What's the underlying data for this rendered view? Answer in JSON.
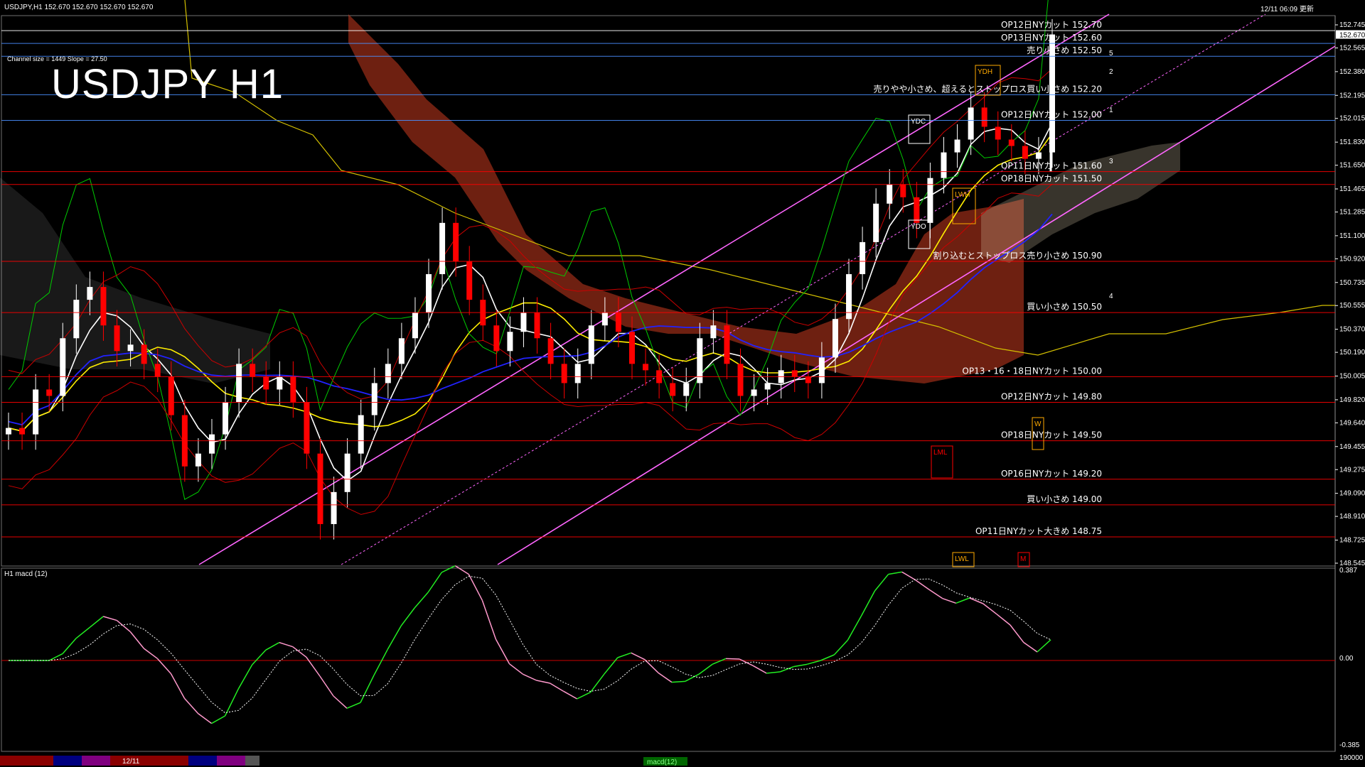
{
  "header": {
    "symbol_line": "USDJPY,H1  152.670 152.670 152.670 152.670",
    "channel_info": "Channel size = 1449 Slope = 27.50",
    "datetime": "12/11 06:09 更新",
    "big_title": "USDJPY H1",
    "macd_label": "H1  macd (12)"
  },
  "price_axis": {
    "ticks": [
      "152.745",
      "152.565",
      "152.380",
      "152.195",
      "152.015",
      "151.830",
      "151.650",
      "151.465",
      "151.285",
      "151.100",
      "150.920",
      "150.735",
      "150.555",
      "150.370",
      "150.190",
      "150.005",
      "149.820",
      "149.640",
      "149.455",
      "149.275",
      "149.090",
      "148.910",
      "148.725",
      "148.545"
    ],
    "current_price": "152.670"
  },
  "macd_axis": {
    "ticks": [
      "0.387",
      "0.00",
      "-0.385",
      "190000"
    ]
  },
  "bottom_bar": {
    "date_label": "12/11",
    "macd_tag": "macd(12)"
  },
  "colors": {
    "bull": "#ffffff",
    "bear": "#ff0000",
    "cloud": "#c83a1f",
    "channel": "#ff66ff",
    "sma_yellow": "#ffee00",
    "sma_white": "#ffffff",
    "sma_blue": "#2222ff",
    "green_line": "#00cc00",
    "macd_green": "#22ee22",
    "macd_pink": "#ff99cc"
  },
  "chart_data": {
    "type": "line",
    "symbol": "USDJPY",
    "timeframe": "H1",
    "ylim": [
      148.5,
      152.83
    ],
    "levels": [
      {
        "label": "OP12日NYカット 152.70",
        "price": 152.7,
        "color": "#ffffff"
      },
      {
        "label": "OP13日NYカット 152.60",
        "price": 152.6,
        "color": "#4a90ff"
      },
      {
        "label": "売り小さめ 152.50",
        "price": 152.5,
        "color": "#4a90ff"
      },
      {
        "label": "売りやや小さめ、超えるとストップロス買い小さめ 152.20",
        "price": 152.2,
        "color": "#4a90ff"
      },
      {
        "label": "OP12日NYカット 152.00",
        "price": 152.0,
        "color": "#4a90ff"
      },
      {
        "label": "OP11日NYカット 151.60",
        "price": 151.6,
        "color": "#ff0000"
      },
      {
        "label": "OP18日NYカット 151.50",
        "price": 151.5,
        "color": "#ff0000"
      },
      {
        "label": "割り込むとストップロス売り小さめ 150.90",
        "price": 150.9,
        "color": "#ff0000"
      },
      {
        "label": "買い小さめ 150.50",
        "price": 150.5,
        "color": "#ff0000"
      },
      {
        "label": "OP13・16・18日NYカット 150.00",
        "price": 150.0,
        "color": "#ff0000"
      },
      {
        "label": "OP12日NYカット 149.80",
        "price": 149.8,
        "color": "#ff0000"
      },
      {
        "label": "OP18日NYカット 149.50",
        "price": 149.5,
        "color": "#ff0000"
      },
      {
        "label": "OP16日NYカット 149.20",
        "price": 149.2,
        "color": "#ff0000"
      },
      {
        "label": "買い小さめ 149.00",
        "price": 149.0,
        "color": "#ff0000"
      },
      {
        "label": "OP11日NYカット大きめ 148.75",
        "price": 148.75,
        "color": "#ff0000"
      }
    ],
    "box_labels": [
      "YDC",
      "YDO",
      "YDH",
      "LWH",
      "LML",
      "LWL",
      "W",
      "M"
    ],
    "wave_labels": [
      "5",
      "2",
      "1",
      "3",
      "4"
    ],
    "close_series": [
      149.6,
      149.55,
      149.9,
      149.85,
      150.3,
      150.6,
      150.7,
      150.4,
      150.2,
      150.25,
      150.1,
      150.0,
      149.7,
      149.3,
      149.4,
      149.55,
      149.8,
      150.1,
      150.0,
      149.9,
      150.0,
      149.8,
      149.4,
      148.85,
      149.1,
      149.4,
      149.7,
      149.95,
      150.1,
      150.3,
      150.5,
      150.8,
      151.2,
      150.9,
      150.6,
      150.4,
      150.2,
      150.35,
      150.5,
      150.3,
      150.1,
      149.95,
      150.1,
      150.4,
      150.5,
      150.35,
      150.1,
      150.05,
      149.95,
      149.85,
      149.95,
      150.3,
      150.4,
      150.1,
      149.85,
      149.9,
      149.95,
      150.05,
      150.0,
      149.95,
      150.15,
      150.45,
      150.8,
      151.05,
      151.35,
      151.5,
      151.4,
      151.2,
      151.55,
      151.75,
      151.85,
      152.1,
      151.95,
      151.85,
      151.8,
      151.7,
      151.75,
      152.67
    ]
  }
}
